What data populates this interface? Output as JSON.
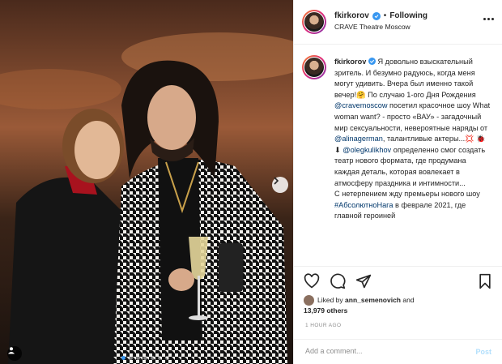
{
  "post": {
    "username": "fkirkorov",
    "separator": "•",
    "follow_status": "Following",
    "location": "CRAVE Theatre Moscow",
    "caption": {
      "username": "fkirkorov",
      "p1": "Я довольно взыскательный зритель. И безумно радуюсь, когда меня могут удивить. Вчера был именно такой вечер!🤗 По случаю 1-ого Дня Рождения ",
      "mention1": "@cravemoscow",
      "p2": " посетил красочное шоу What woman want? - просто «ВАУ» - загадочный мир сексуальности, невероятные наряды от ",
      "mention2": "@alinagerman",
      "p3": ", талантливые актеры...💢 🐞 ⬇ ",
      "mention3": "@olegkulikhov",
      "p4": " определенно смог создать театр нового формата, где продумана каждая деталь, которая вовлекает в атмосферу праздника и интимности...",
      "p5": "С нетерпением жду премьеры нового шоу ",
      "hashtag": "#АбсолютноНага",
      "p6": " в феврале 2021, где главной героиней"
    },
    "likes": {
      "prefix": "Liked by ",
      "user": "ann_semenovich",
      "middle": " and",
      "count": "13,979 others"
    },
    "time": "1 HOUR AGO",
    "comment": {
      "placeholder": "Add a comment...",
      "post_label": "Post"
    }
  },
  "carousel": {
    "slides": 7,
    "active": 1
  },
  "icons": {
    "verified": "verified-badge-icon",
    "more": "more-options-icon",
    "like": "heart-icon",
    "comment": "comment-icon",
    "share": "share-icon",
    "save": "bookmark-icon",
    "next": "chevron-right-icon",
    "tag": "user-tag-icon"
  },
  "colors": {
    "accent": "#3897f0",
    "link": "#00376b",
    "muted": "#8e8e8e",
    "post_disabled": "#b2dffc"
  }
}
